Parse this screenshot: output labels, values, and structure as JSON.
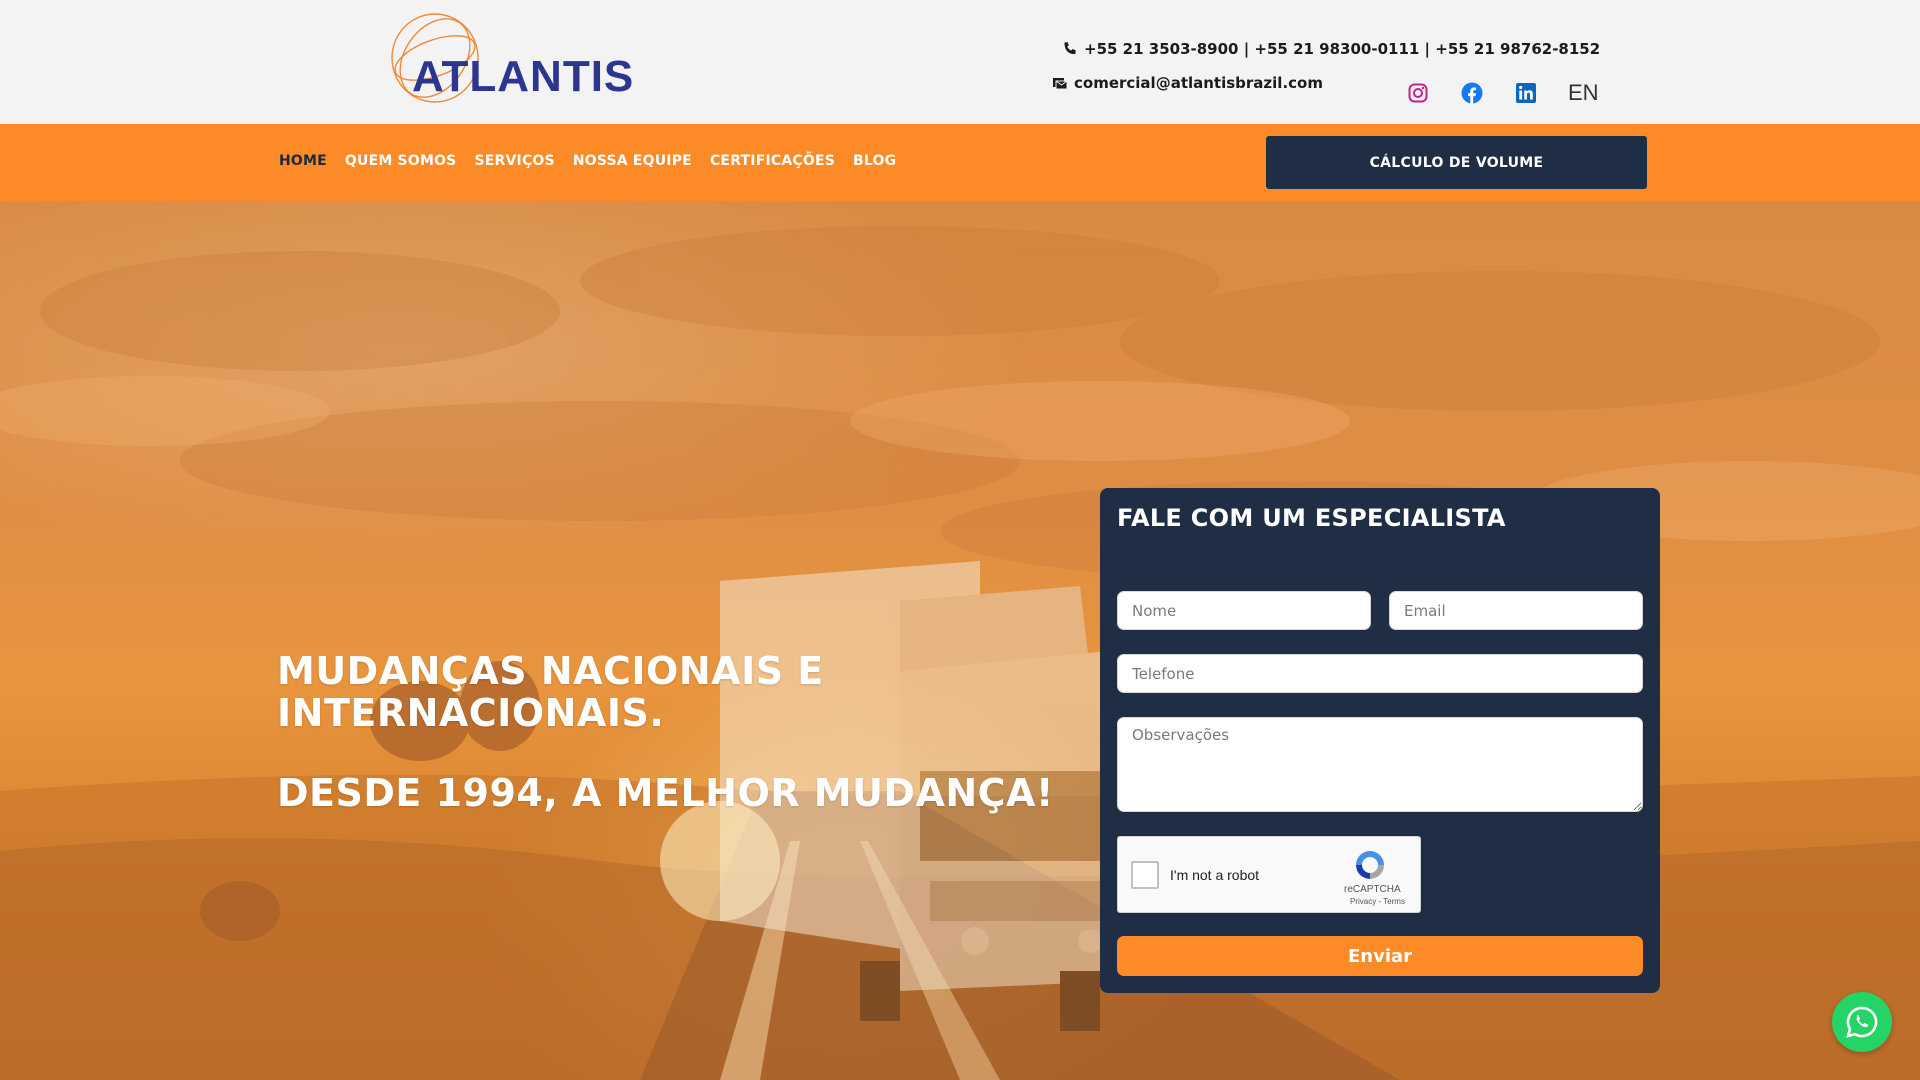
{
  "header": {
    "logo_text": "ATLANTIS",
    "phones": "+55 21 3503-8900 | +55 21 98300-0111 | +55 21 98762-8152",
    "email": "comercial@atlantisbrazil.com",
    "language": "EN",
    "socials": [
      "instagram-icon",
      "facebook-icon",
      "linkedin-icon"
    ]
  },
  "nav": {
    "items": [
      {
        "label": "HOME",
        "active": true
      },
      {
        "label": "QUEM SOMOS"
      },
      {
        "label": "SERVIÇOS"
      },
      {
        "label": "NOSSA EQUIPE"
      },
      {
        "label": "CERTIFICAÇÕES"
      },
      {
        "label": "BLOG"
      }
    ],
    "cta_label": "CÁLCULO DE VOLUME"
  },
  "hero": {
    "line1": "MUDANÇAS NACIONAIS E",
    "line2": "INTERNACIONAIS.",
    "line3": "DESDE 1994, A MELHOR MUDANÇA!"
  },
  "form": {
    "title": "FALE COM UM ESPECIALISTA",
    "nome_placeholder": "Nome",
    "email_placeholder": "Email",
    "telefone_placeholder": "Telefone",
    "obs_placeholder": "Observações",
    "recaptcha_label": "I'm not a robot",
    "recaptcha_brand": "reCAPTCHA",
    "recaptcha_links": "Privacy - Terms",
    "submit_label": "Enviar"
  },
  "colors": {
    "orange": "#fc8a27",
    "navy": "#1f2e44",
    "logo_blue": "#2c3590",
    "whatsapp": "#25d366"
  }
}
